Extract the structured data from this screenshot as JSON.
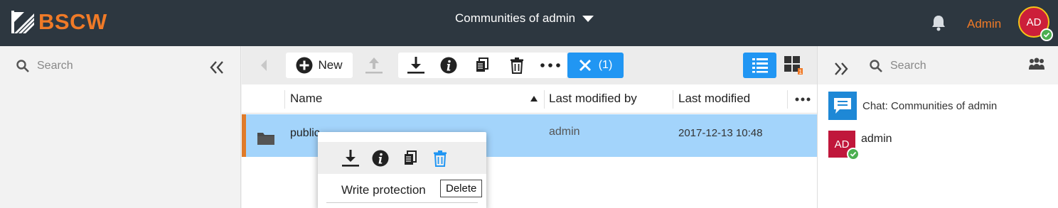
{
  "app": {
    "logo_text": "BSCW",
    "brand_color": "#f07a27"
  },
  "header": {
    "community_title": "Communities of admin",
    "user_label": "Admin",
    "avatar_initials": "AD",
    "icons": [
      "bell-icon",
      "chevron-down-icon"
    ]
  },
  "left": {
    "search_placeholder": "Search",
    "collapse_icon": "double-chevron-left-icon"
  },
  "toolbar": {
    "new_label": "New",
    "selection_label": "(1)",
    "icons": [
      "back-icon",
      "plus-icon",
      "upload-icon",
      "download-icon",
      "info-icon",
      "copy-icon",
      "trash-icon",
      "more-icon",
      "close-icon",
      "list-view-icon",
      "grid-view-icon"
    ]
  },
  "table": {
    "columns": [
      "Name",
      "Last modified by",
      "Last modified"
    ],
    "sort_column": "Name",
    "rows": [
      {
        "name": "public",
        "modified_by": "admin",
        "modified": "2017-12-13 10:48",
        "icon": "folder-icon",
        "selected": true
      }
    ]
  },
  "context_menu": {
    "icons": [
      "download-icon",
      "info-icon",
      "copy-icon",
      "trash-icon"
    ],
    "items": [
      "Write protection"
    ],
    "tooltip": "Delete"
  },
  "right": {
    "search_placeholder": "Search",
    "chat_label": "Chat: Communities of admin",
    "member": {
      "initials": "AD",
      "name": "admin"
    }
  },
  "colors": {
    "header_bg": "#2d3740",
    "accent_blue": "#2196f3",
    "selected_row": "#a3d4fb",
    "avatar_red": "#c0173b"
  }
}
